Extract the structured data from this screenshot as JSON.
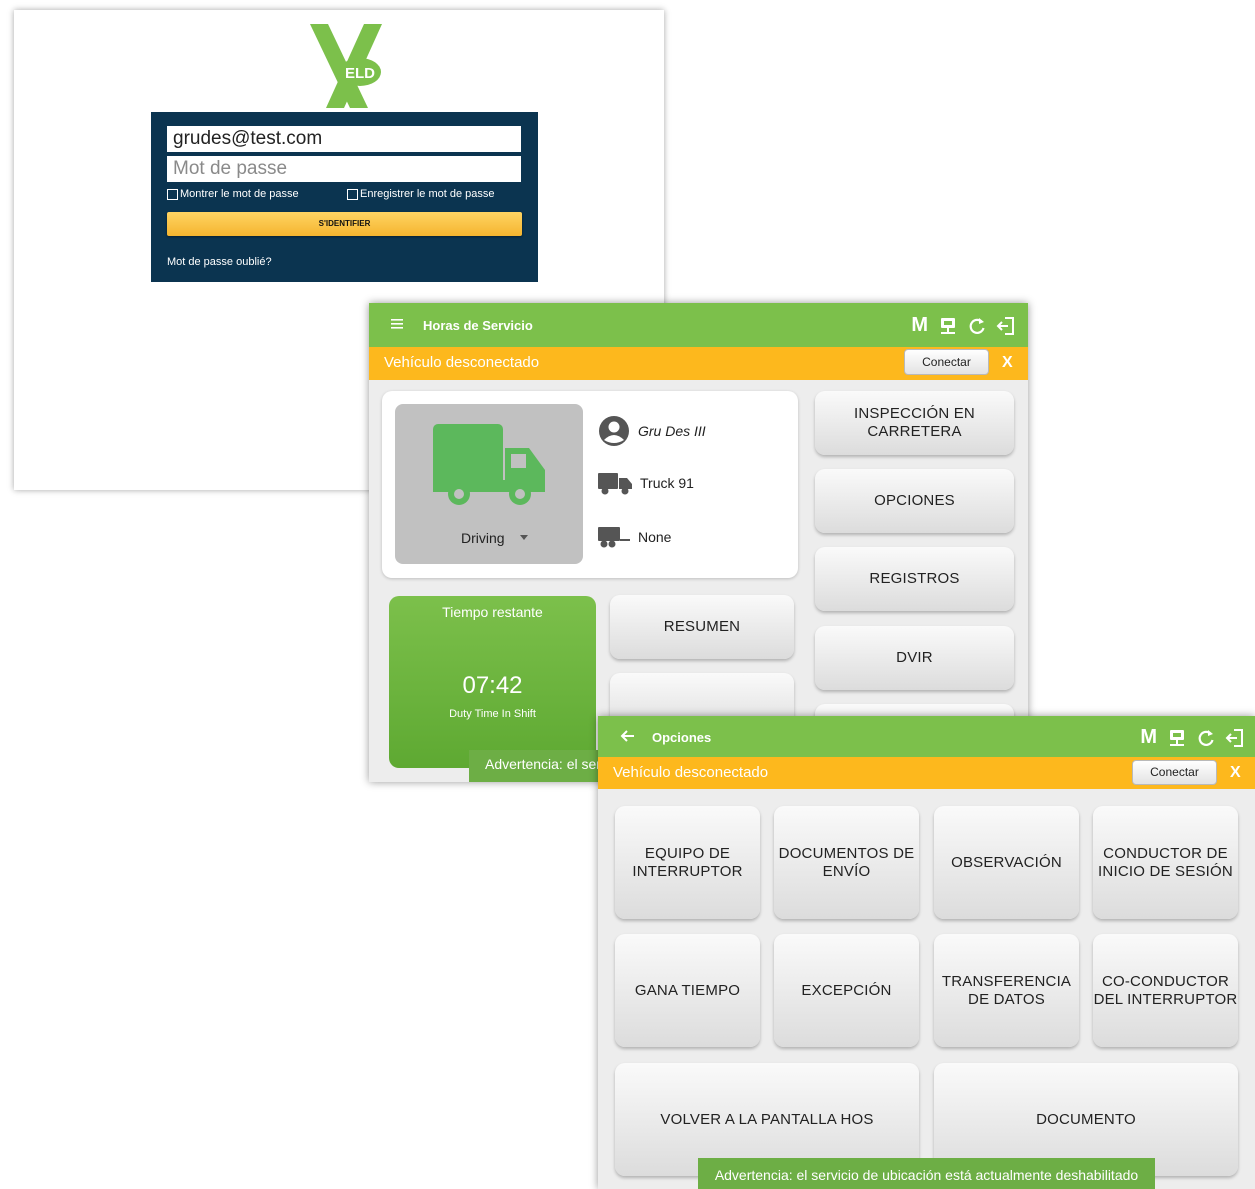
{
  "login": {
    "logo_text": "ELD",
    "email_value": "grudes@test.com",
    "password_placeholder": "Mot de passe",
    "show_password_label": "Montrer le mot de passe",
    "save_password_label": "Enregistrer le mot de passe",
    "signin_label": "S'IDENTIFIER",
    "forgot_label": "Mot de passe oublié?"
  },
  "hos": {
    "title": "Horas de Servicio",
    "m_label": "M",
    "disconnected_msg": "Vehículo desconectado",
    "connect_label": "Conectar",
    "close_label": "X",
    "status": "Driving",
    "driver_name": "Gru Des III",
    "vehicle": "Truck 91",
    "trailer": "None",
    "timer_title": "Tiempo restante",
    "timer_value": "07:42",
    "timer_caption": "Duty Time In Shift",
    "buttons": {
      "inspection": "INSPECCIÓN EN CARRETERA",
      "options": "OPCIONES",
      "logs": "REGISTROS",
      "dvir": "DVIR",
      "summary": "RESUMEN"
    },
    "toast": "Advertencia: el servicio de ubicación está actualmente deshabilitado"
  },
  "options": {
    "title": "Opciones",
    "m_label": "M",
    "disconnected_msg": "Vehículo desconectado",
    "connect_label": "Conectar",
    "close_label": "X",
    "buttons": [
      "EQUIPO DE INTERRUPTOR",
      "DOCUMENTOS DE ENVÍO",
      "OBSERVACIÓN",
      "CONDUCTOR DE INICIO DE SESIÓN",
      "GANA TIEMPO",
      "EXCEPCIÓN",
      "TRANSFERENCIA DE DATOS",
      "CO-CONDUCTOR DEL INTERRUPTOR",
      "VOLVER A LA PANTALLA HOS",
      "DOCUMENTO"
    ],
    "toast": "Advertencia: el servicio de ubicación está actualmente deshabilitado"
  },
  "colors": {
    "green": "#7cc04b",
    "amber": "#fdb81d",
    "navy": "#0b3450",
    "truck_green": "#5cb85c"
  }
}
